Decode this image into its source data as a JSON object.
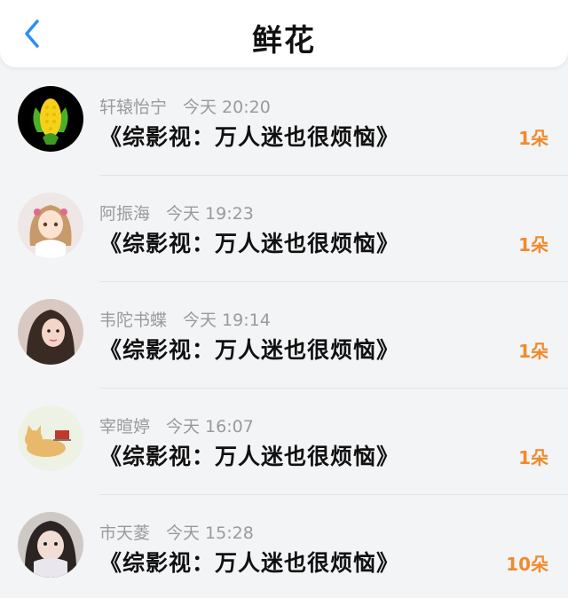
{
  "header": {
    "title": "鲜花",
    "back_icon": "chevron-left-icon",
    "accent_color": "#2b8ff5"
  },
  "items": [
    {
      "user": "轩辕怡宁",
      "time": "今天  20:20",
      "book": "《综影视：万人迷也很烦恼》",
      "count": "1朵",
      "avatar": "corn"
    },
    {
      "user": "阿振海",
      "time": "今天  19:23",
      "book": "《综影视：万人迷也很烦恼》",
      "count": "1朵",
      "avatar": "anime-girl"
    },
    {
      "user": "韦陀书蝶",
      "time": "今天  19:14",
      "book": "《综影视：万人迷也很烦恼》",
      "count": "1朵",
      "avatar": "woman-photo"
    },
    {
      "user": "宰暄婷",
      "time": "今天  16:07",
      "book": "《综影视：万人迷也很烦恼》",
      "count": "1朵",
      "avatar": "cat-drawing"
    },
    {
      "user": "市天菱",
      "time": "今天  15:28",
      "book": "《综影视：万人迷也很烦恼》",
      "count": "10朵",
      "avatar": "girl-photo"
    }
  ],
  "colors": {
    "count": "#f08a2c",
    "meta": "#9a9a9a",
    "background": "#f3f4f6"
  }
}
